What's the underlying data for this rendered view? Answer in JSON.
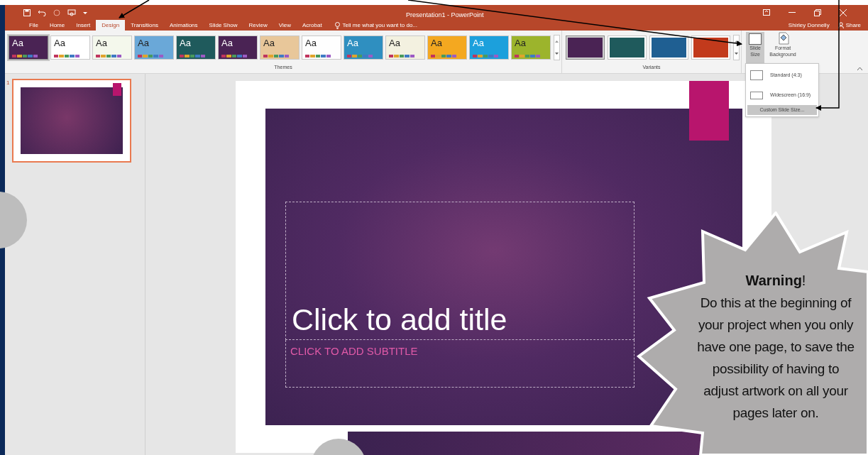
{
  "window": {
    "title": "Presentation1 - PowerPoint",
    "user": "Shirley Donnelly",
    "share": "Share"
  },
  "tabs": [
    {
      "label": "File",
      "selected": false
    },
    {
      "label": "Home",
      "selected": false
    },
    {
      "label": "Insert",
      "selected": false
    },
    {
      "label": "Design",
      "selected": true
    },
    {
      "label": "Transitions",
      "selected": false
    },
    {
      "label": "Animations",
      "selected": false
    },
    {
      "label": "Slide Show",
      "selected": false
    },
    {
      "label": "Review",
      "selected": false
    },
    {
      "label": "View",
      "selected": false
    },
    {
      "label": "Acrobat",
      "selected": false
    }
  ],
  "tell_me": {
    "placeholder": "Tell me what you want to do..."
  },
  "themes": {
    "label": "Themes",
    "items": [
      {
        "text": "Aa",
        "color": "#4a2354",
        "selected": true
      },
      {
        "text": "Aa",
        "color": "#ffffff",
        "selected": false
      },
      {
        "text": "Aa",
        "color": "#f4f8ec",
        "selected": false
      },
      {
        "text": "Aa",
        "color": "#6aa8d8",
        "selected": false
      },
      {
        "text": "Aa",
        "color": "#1f5a5c",
        "selected": false
      },
      {
        "text": "Aa",
        "color": "#4a2354",
        "selected": false
      },
      {
        "text": "Aa",
        "color": "#e8c79a",
        "selected": false
      },
      {
        "text": "Aa",
        "color": "#fefefe",
        "selected": false
      },
      {
        "text": "Aa",
        "color": "#2f8fc0",
        "selected": false
      },
      {
        "text": "Aa",
        "color": "#f3f1e0",
        "selected": false
      },
      {
        "text": "Aa",
        "color": "#f4a820",
        "selected": false
      },
      {
        "text": "Aa",
        "color": "#1ca0dc",
        "selected": false
      },
      {
        "text": "Aa",
        "color": "#9cb42c",
        "selected": false
      }
    ]
  },
  "variants": {
    "label": "Variants",
    "items": [
      {
        "color": "#4a2354",
        "selected": true
      },
      {
        "color": "#1f5a5c",
        "selected": false
      },
      {
        "color": "#1f5f92",
        "selected": false
      },
      {
        "color": "#c23a1c",
        "selected": false
      }
    ]
  },
  "slide_size": {
    "label": "Slide Size",
    "expanded": true
  },
  "format_background": {
    "label": "Format Background"
  },
  "slide_size_menu": [
    {
      "label": "Standard (4:3)",
      "kind": "option",
      "selected": false
    },
    {
      "label": "Widescreen (16:9)",
      "kind": "option",
      "selected": false
    },
    {
      "label": "Custom Slide Size...",
      "kind": "command",
      "selected": true
    }
  ],
  "thumbnails": [
    {
      "number": "1",
      "selected": true
    }
  ],
  "slide": {
    "title": "Click to add title",
    "subtitle": "CLICK TO ADD SUBTITLE"
  },
  "callout": {
    "heading": "**Warning**!",
    "text": "Do this at the beginning of your project when you only have one page, to save the possibility of having to adjust artwork on all your pages later on."
  }
}
